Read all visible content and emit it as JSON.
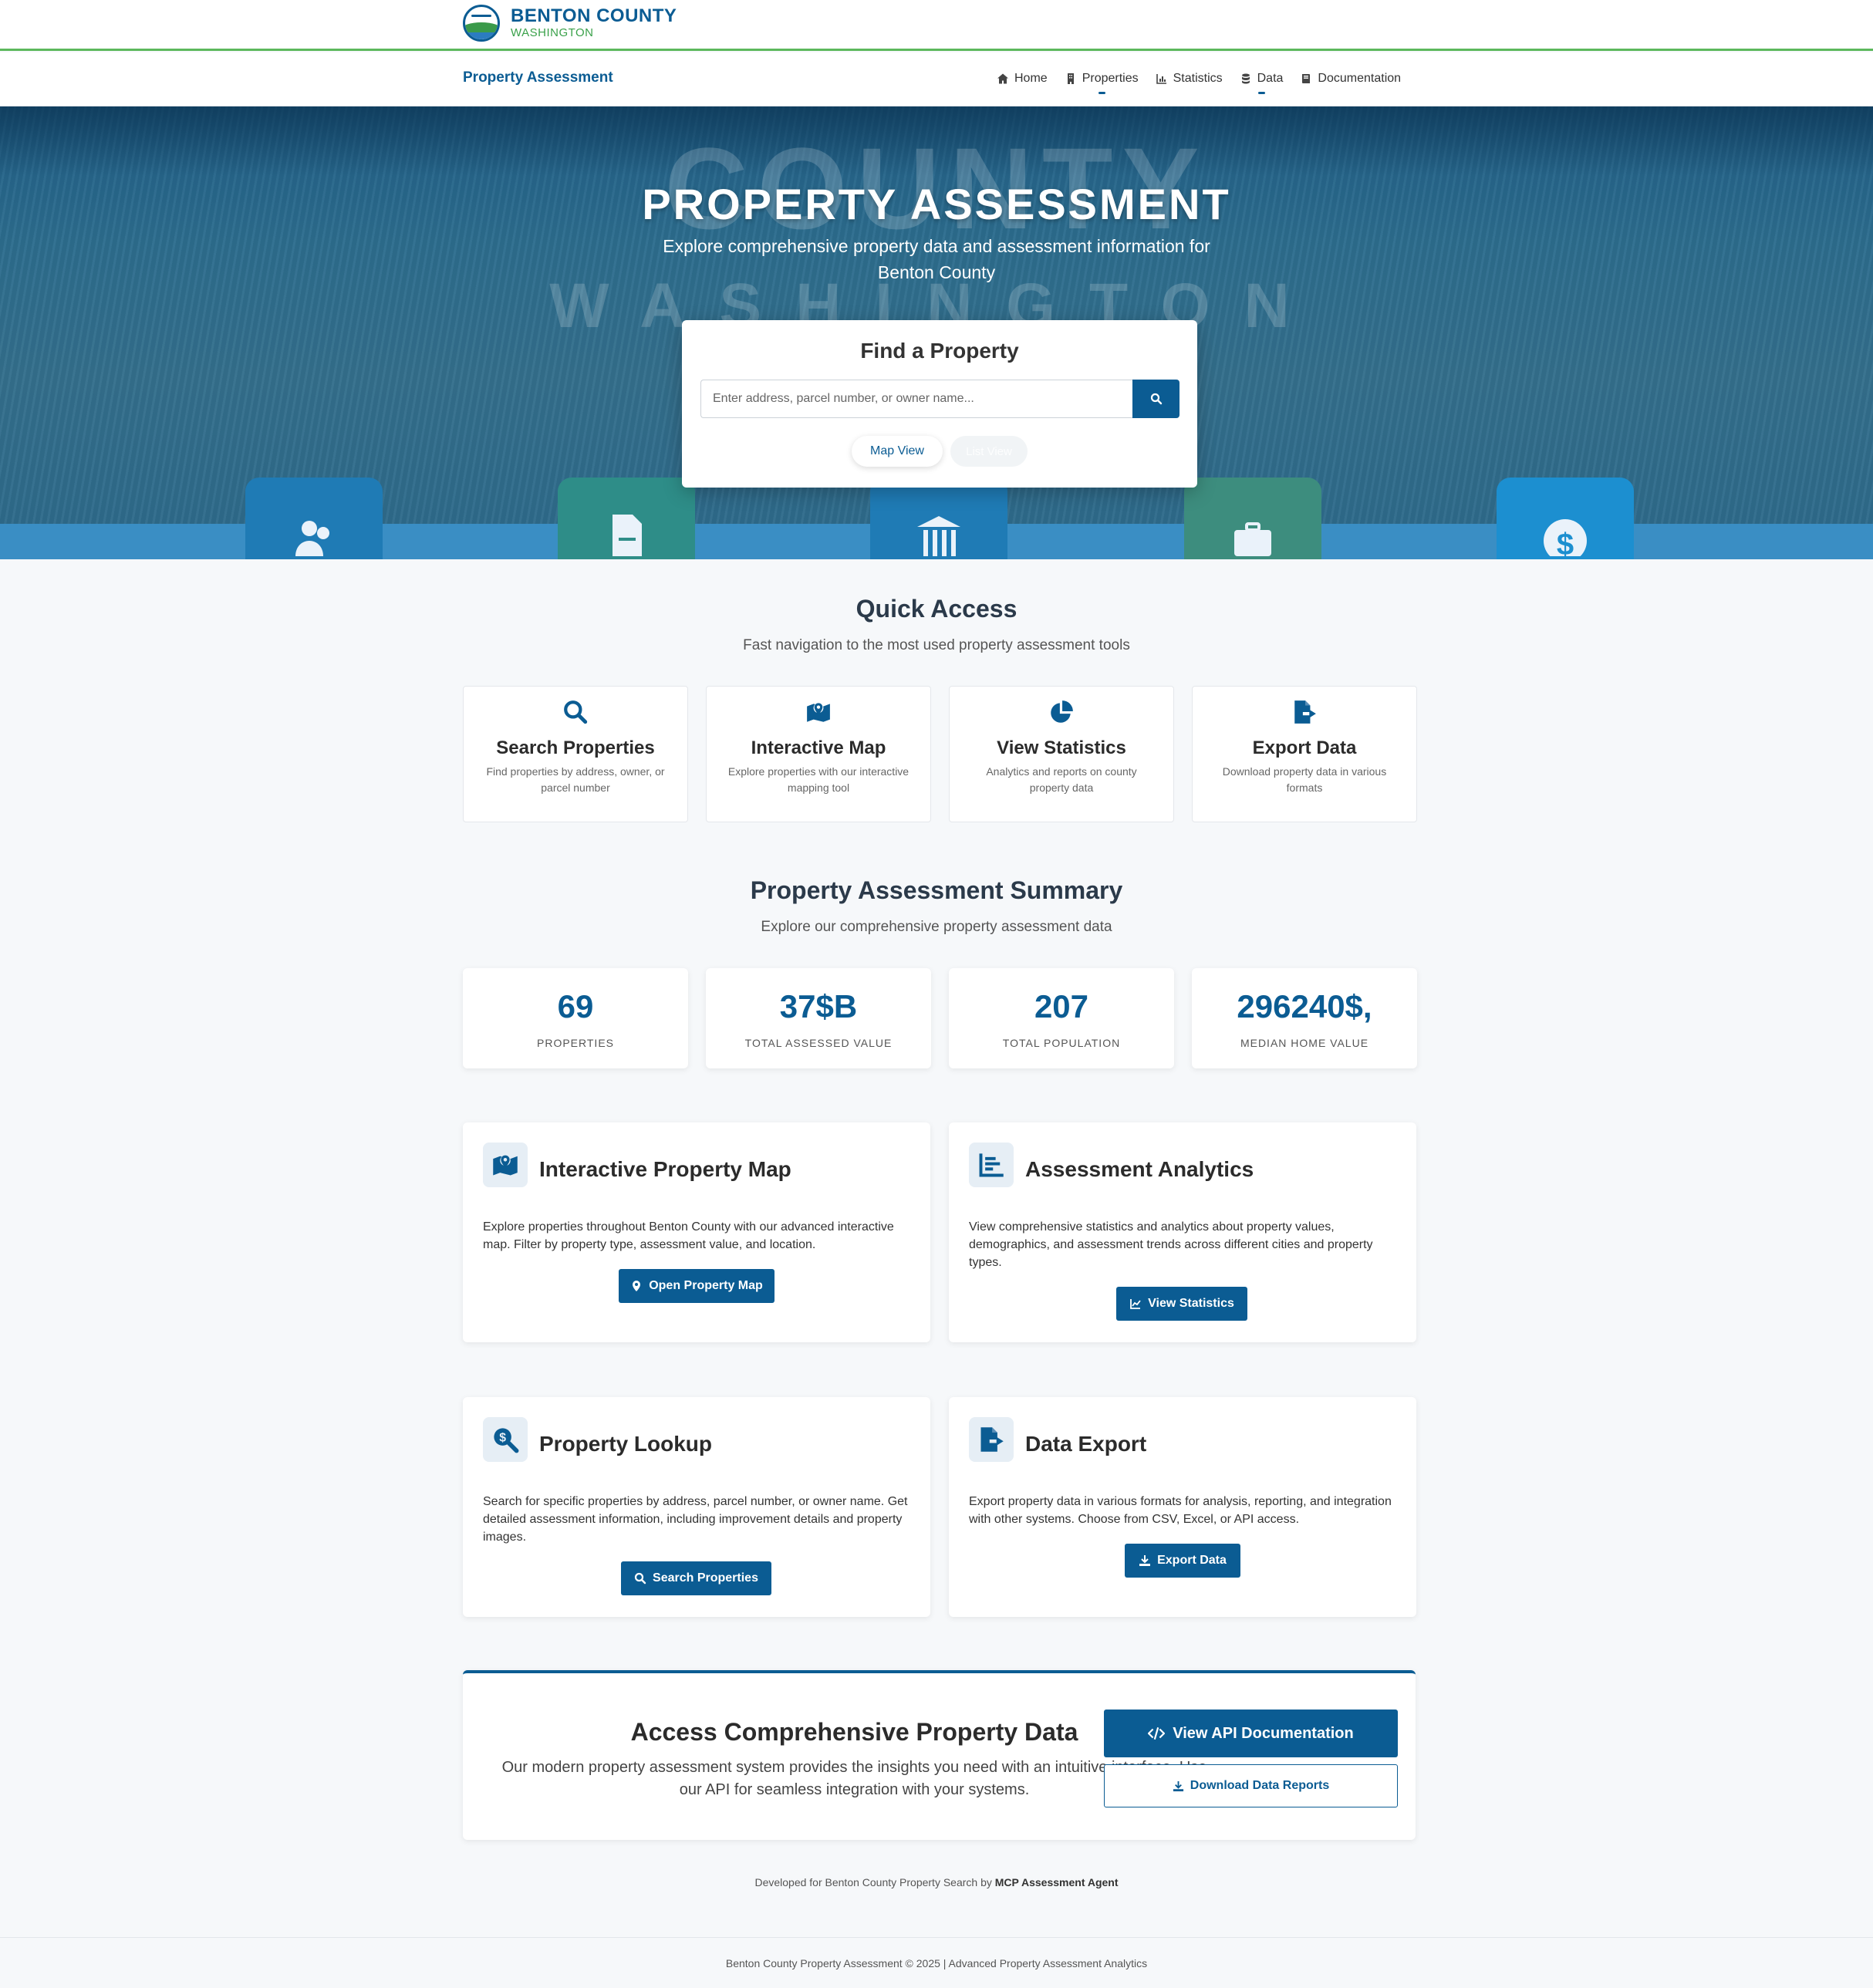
{
  "brand": {
    "name": "BENTON COUNTY",
    "sub": "WASHINGTON"
  },
  "nav": {
    "title": "Property Assessment",
    "links": [
      {
        "label": "Home",
        "icon": "home-icon"
      },
      {
        "label": "Properties",
        "icon": "building-icon"
      },
      {
        "label": "Statistics",
        "icon": "chart-icon"
      },
      {
        "label": "Data",
        "icon": "database-icon"
      },
      {
        "label": "Documentation",
        "icon": "book-icon"
      }
    ]
  },
  "hero": {
    "watermark_1": "COUNTY",
    "watermark_2": "WASHINGTON",
    "title": "PROPERTY ASSESSMENT",
    "subtitle": "Explore comprehensive property data and assessment information for Benton County",
    "search": {
      "title": "Find a Property",
      "placeholder": "Enter address, parcel number, or owner name...",
      "map_view_label": "Map View",
      "list_view_label": "List View"
    }
  },
  "quick_access": {
    "title": "Quick Access",
    "subtitle": "Fast navigation to the most used property assessment tools",
    "cards": [
      {
        "title": "Search Properties",
        "desc": "Find properties by address, owner, or parcel number",
        "icon": "search-icon"
      },
      {
        "title": "Interactive Map",
        "desc": "Explore properties with our interactive mapping tool",
        "icon": "map-icon"
      },
      {
        "title": "View Statistics",
        "desc": "Analytics and reports on county property data",
        "icon": "pie-chart-icon"
      },
      {
        "title": "Export Data",
        "desc": "Download property data in various formats",
        "icon": "file-export-icon"
      }
    ]
  },
  "summary": {
    "title": "Property Assessment Summary",
    "subtitle": "Explore our comprehensive property assessment data",
    "stats": [
      {
        "value": "69",
        "label": "PROPERTIES"
      },
      {
        "value": "37$B",
        "label": "TOTAL ASSESSED VALUE"
      },
      {
        "value": "207",
        "label": "TOTAL POPULATION"
      },
      {
        "value": "296240$,",
        "label": "MEDIAN HOME VALUE"
      }
    ]
  },
  "features": [
    {
      "title": "Interactive Property Map",
      "desc": "Explore properties throughout Benton County with our advanced interactive map. Filter by property type, assessment value, and location.",
      "button": "Open Property Map",
      "icon": "map-icon"
    },
    {
      "title": "Assessment Analytics",
      "desc": "View comprehensive statistics and analytics about property values, demographics, and assessment trends across different cities and property types.",
      "button": "View Statistics",
      "icon": "bar-chart-icon"
    },
    {
      "title": "Property Lookup",
      "desc": "Search for specific properties by address, parcel number, or owner name. Get detailed assessment information, including improvement details and property images.",
      "button": "Search Properties",
      "icon": "search-dollar-icon"
    },
    {
      "title": "Data Export",
      "desc": "Export property data in various formats for analysis, reporting, and integration with other systems. Choose from CSV, Excel, or API access.",
      "button": "Export Data",
      "icon": "file-export-icon"
    }
  ],
  "api": {
    "title": "Access Comprehensive Property Data",
    "desc": "Our modern property assessment system provides the insights you need with an intuitive interface. Use our API for seamless integration with your systems.",
    "btn_docs": "View API Documentation",
    "btn_reports": "Download Data Reports"
  },
  "dev_line": {
    "prefix": "Developed for Benton County Property Search by ",
    "agent": "MCP Assessment Agent"
  },
  "footer": {
    "text": "Benton County Property Assessment © 2025 | Advanced Property Assessment Analytics"
  },
  "colors": {
    "primary": "#0b5c93",
    "accent_green": "#5cb85c",
    "hero_blue": "#2d6d8e"
  }
}
